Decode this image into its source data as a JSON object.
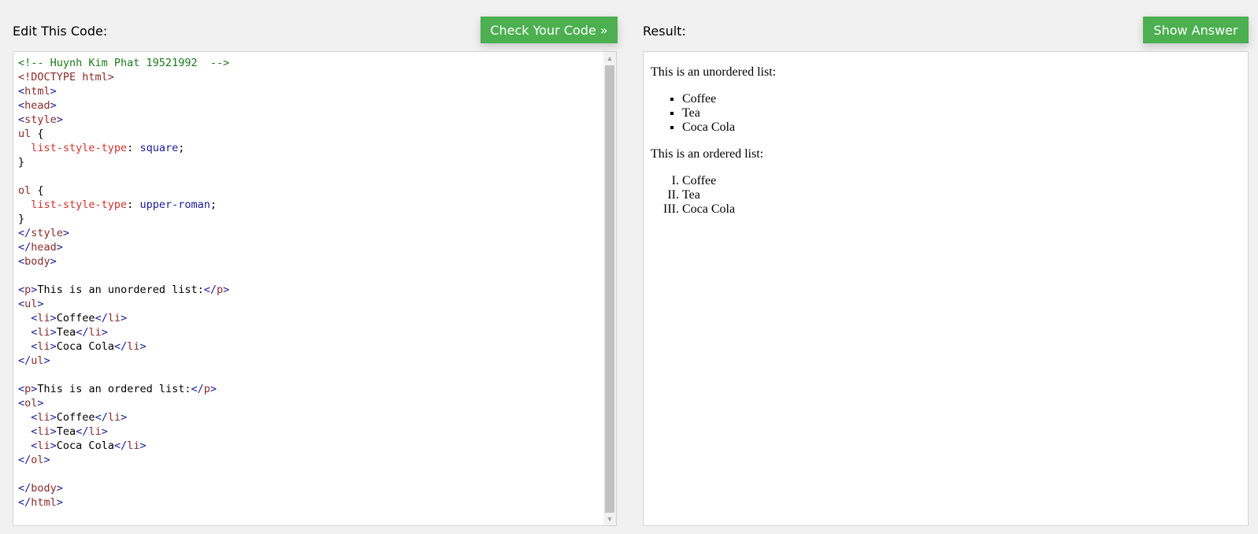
{
  "header": {
    "edit_label": "Edit This Code:",
    "check_button": "Check Your Code »",
    "result_label": "Result:",
    "answer_button": "Show Answer"
  },
  "code_lines": [
    [
      {
        "t": "<!-- Huynh Kim Phat 19521992  -->",
        "c": "c-com"
      }
    ],
    [
      {
        "t": "<!DOCTYPE html>",
        "c": "c-tag"
      }
    ],
    [
      {
        "t": "<",
        "c": "c-bracket"
      },
      {
        "t": "html",
        "c": "c-tag"
      },
      {
        "t": ">",
        "c": "c-bracket"
      }
    ],
    [
      {
        "t": "<",
        "c": "c-bracket"
      },
      {
        "t": "head",
        "c": "c-tag"
      },
      {
        "t": ">",
        "c": "c-bracket"
      }
    ],
    [
      {
        "t": "<",
        "c": "c-bracket"
      },
      {
        "t": "style",
        "c": "c-tag"
      },
      {
        "t": ">",
        "c": "c-bracket"
      }
    ],
    [
      {
        "t": "ul",
        "c": "c-tag"
      },
      {
        "t": " {",
        "c": "c-txt"
      }
    ],
    [
      {
        "t": "  list-style-type",
        "c": "c-prop"
      },
      {
        "t": ": ",
        "c": "c-txt"
      },
      {
        "t": "square",
        "c": "c-val"
      },
      {
        "t": ";",
        "c": "c-txt"
      }
    ],
    [
      {
        "t": "}",
        "c": "c-txt"
      }
    ],
    [],
    [
      {
        "t": "ol",
        "c": "c-tag"
      },
      {
        "t": " {",
        "c": "c-txt"
      }
    ],
    [
      {
        "t": "  list-style-type",
        "c": "c-prop"
      },
      {
        "t": ": ",
        "c": "c-txt"
      },
      {
        "t": "upper-roman",
        "c": "c-val"
      },
      {
        "t": ";",
        "c": "c-txt"
      }
    ],
    [
      {
        "t": "}",
        "c": "c-txt"
      }
    ],
    [
      {
        "t": "</",
        "c": "c-bracket"
      },
      {
        "t": "style",
        "c": "c-tag"
      },
      {
        "t": ">",
        "c": "c-bracket"
      }
    ],
    [
      {
        "t": "</",
        "c": "c-bracket"
      },
      {
        "t": "head",
        "c": "c-tag"
      },
      {
        "t": ">",
        "c": "c-bracket"
      }
    ],
    [
      {
        "t": "<",
        "c": "c-bracket"
      },
      {
        "t": "body",
        "c": "c-tag"
      },
      {
        "t": ">",
        "c": "c-bracket"
      }
    ],
    [],
    [
      {
        "t": "<",
        "c": "c-bracket"
      },
      {
        "t": "p",
        "c": "c-tag"
      },
      {
        "t": ">",
        "c": "c-bracket"
      },
      {
        "t": "This is an unordered list:",
        "c": "c-txt"
      },
      {
        "t": "</",
        "c": "c-bracket"
      },
      {
        "t": "p",
        "c": "c-tag"
      },
      {
        "t": ">",
        "c": "c-bracket"
      }
    ],
    [
      {
        "t": "<",
        "c": "c-bracket"
      },
      {
        "t": "ul",
        "c": "c-tag"
      },
      {
        "t": ">",
        "c": "c-bracket"
      }
    ],
    [
      {
        "t": "  <",
        "c": "c-bracket"
      },
      {
        "t": "li",
        "c": "c-tag"
      },
      {
        "t": ">",
        "c": "c-bracket"
      },
      {
        "t": "Coffee",
        "c": "c-txt"
      },
      {
        "t": "</",
        "c": "c-bracket"
      },
      {
        "t": "li",
        "c": "c-tag"
      },
      {
        "t": ">",
        "c": "c-bracket"
      }
    ],
    [
      {
        "t": "  <",
        "c": "c-bracket"
      },
      {
        "t": "li",
        "c": "c-tag"
      },
      {
        "t": ">",
        "c": "c-bracket"
      },
      {
        "t": "Tea",
        "c": "c-txt"
      },
      {
        "t": "</",
        "c": "c-bracket"
      },
      {
        "t": "li",
        "c": "c-tag"
      },
      {
        "t": ">",
        "c": "c-bracket"
      }
    ],
    [
      {
        "t": "  <",
        "c": "c-bracket"
      },
      {
        "t": "li",
        "c": "c-tag"
      },
      {
        "t": ">",
        "c": "c-bracket"
      },
      {
        "t": "Coca Cola",
        "c": "c-txt"
      },
      {
        "t": "</",
        "c": "c-bracket"
      },
      {
        "t": "li",
        "c": "c-tag"
      },
      {
        "t": ">",
        "c": "c-bracket"
      }
    ],
    [
      {
        "t": "</",
        "c": "c-bracket"
      },
      {
        "t": "ul",
        "c": "c-tag"
      },
      {
        "t": ">",
        "c": "c-bracket"
      }
    ],
    [],
    [
      {
        "t": "<",
        "c": "c-bracket"
      },
      {
        "t": "p",
        "c": "c-tag"
      },
      {
        "t": ">",
        "c": "c-bracket"
      },
      {
        "t": "This is an ordered list:",
        "c": "c-txt"
      },
      {
        "t": "</",
        "c": "c-bracket"
      },
      {
        "t": "p",
        "c": "c-tag"
      },
      {
        "t": ">",
        "c": "c-bracket"
      }
    ],
    [
      {
        "t": "<",
        "c": "c-bracket"
      },
      {
        "t": "ol",
        "c": "c-tag"
      },
      {
        "t": ">",
        "c": "c-bracket"
      }
    ],
    [
      {
        "t": "  <",
        "c": "c-bracket"
      },
      {
        "t": "li",
        "c": "c-tag"
      },
      {
        "t": ">",
        "c": "c-bracket"
      },
      {
        "t": "Coffee",
        "c": "c-txt"
      },
      {
        "t": "</",
        "c": "c-bracket"
      },
      {
        "t": "li",
        "c": "c-tag"
      },
      {
        "t": ">",
        "c": "c-bracket"
      }
    ],
    [
      {
        "t": "  <",
        "c": "c-bracket"
      },
      {
        "t": "li",
        "c": "c-tag"
      },
      {
        "t": ">",
        "c": "c-bracket"
      },
      {
        "t": "Tea",
        "c": "c-txt"
      },
      {
        "t": "</",
        "c": "c-bracket"
      },
      {
        "t": "li",
        "c": "c-tag"
      },
      {
        "t": ">",
        "c": "c-bracket"
      }
    ],
    [
      {
        "t": "  <",
        "c": "c-bracket"
      },
      {
        "t": "li",
        "c": "c-tag"
      },
      {
        "t": ">",
        "c": "c-bracket"
      },
      {
        "t": "Coca Cola",
        "c": "c-txt"
      },
      {
        "t": "</",
        "c": "c-bracket"
      },
      {
        "t": "li",
        "c": "c-tag"
      },
      {
        "t": ">",
        "c": "c-bracket"
      }
    ],
    [
      {
        "t": "</",
        "c": "c-bracket"
      },
      {
        "t": "ol",
        "c": "c-tag"
      },
      {
        "t": ">",
        "c": "c-bracket"
      }
    ],
    [],
    [
      {
        "t": "</",
        "c": "c-bracket"
      },
      {
        "t": "body",
        "c": "c-tag"
      },
      {
        "t": ">",
        "c": "c-bracket"
      }
    ],
    [
      {
        "t": "</",
        "c": "c-bracket"
      },
      {
        "t": "html",
        "c": "c-tag"
      },
      {
        "t": ">",
        "c": "c-bracket"
      }
    ]
  ],
  "result": {
    "unordered_intro": "This is an unordered list:",
    "unordered_items": [
      "Coffee",
      "Tea",
      "Coca Cola"
    ],
    "ordered_intro": "This is an ordered list:",
    "ordered_items": [
      "Coffee",
      "Tea",
      "Coca Cola"
    ]
  },
  "colors": {
    "button_bg": "#4caf50",
    "page_bg": "#f1f1f1"
  },
  "icons": {
    "scroll_up": "triangle-up-icon",
    "scroll_down": "triangle-down-icon"
  }
}
